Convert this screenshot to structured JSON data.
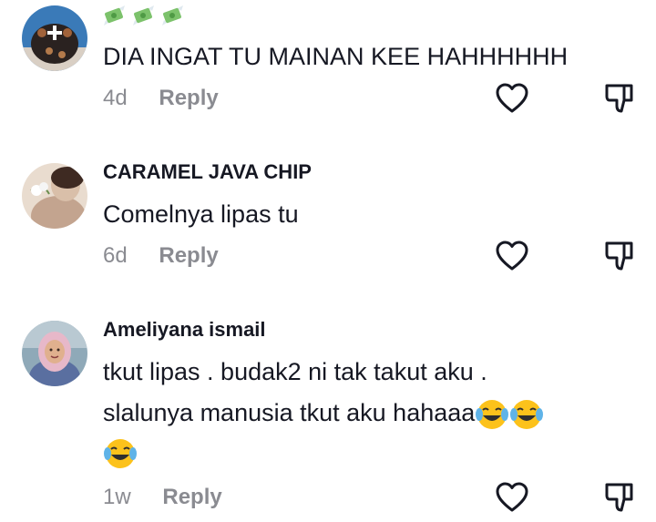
{
  "comments": [
    {
      "username": "",
      "decoration": "💸💸💸",
      "lines": [
        "DIA INGAT TU MAINAN KEE HAHHHHHH"
      ],
      "time": "4d",
      "reply": "Reply"
    },
    {
      "username": "CARAMEL JAVA CHIP",
      "lines": [
        "Comelnya lipas tu"
      ],
      "time": "6d",
      "reply": "Reply"
    },
    {
      "username": "Ameliyana ismail",
      "lines": [
        "tkut lipas . budak2 ni tak takut aku .",
        "slalunya manusia tkut aku hahaaa"
      ],
      "trailing_emoji": "😂😂",
      "last_line_emoji": "😂",
      "time": "1w",
      "reply": "Reply"
    }
  ],
  "icons": {
    "like": "heart-outline-icon",
    "dislike": "thumbs-down-outline-icon",
    "money": "money-with-wings-icon",
    "laugh": "face-with-tears-of-joy-icon"
  },
  "colors": {
    "text": "#161823",
    "muted": "#8a8b91",
    "background": "#ffffff"
  }
}
